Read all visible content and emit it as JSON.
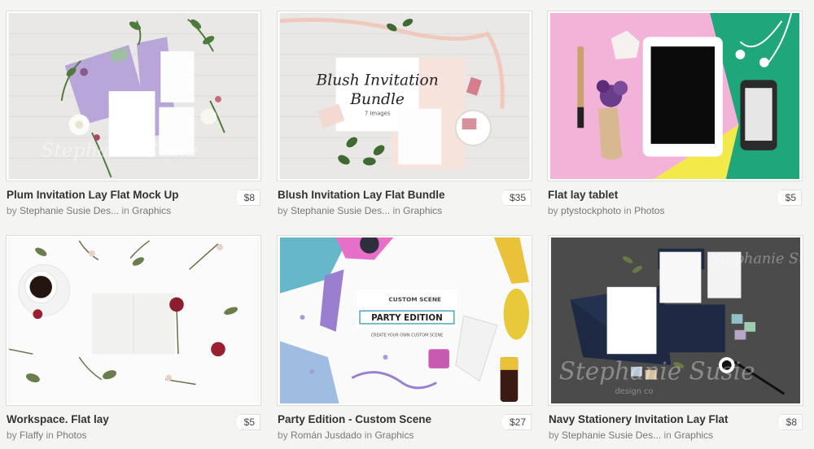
{
  "products": [
    {
      "title": "Plum Invitation Lay Flat Mock Up",
      "author": "Stephanie Susie Des...",
      "in_word": "in",
      "by_word": "by",
      "category": "Graphics",
      "price": "$8",
      "watermark": "Stephanie Susie"
    },
    {
      "title": "Blush Invitation Lay Flat Bundle",
      "author": "Stephanie Susie Des...",
      "in_word": "in",
      "by_word": "by",
      "category": "Graphics",
      "price": "$35",
      "card_title_line1": "Blush Invitation",
      "card_title_line2": "Bundle",
      "card_subtitle": "7 Images"
    },
    {
      "title": "Flat lay tablet",
      "author": "ptystockphoto",
      "in_word": "in",
      "by_word": "by",
      "category": "Photos",
      "price": "$5"
    },
    {
      "title": "Workspace. Flat lay",
      "author": "Flaffy",
      "in_word": "in",
      "by_word": "by",
      "category": "Photos",
      "price": "$5"
    },
    {
      "title": "Party Edition - Custom Scene",
      "author": "Román Jusdado",
      "in_word": "in",
      "by_word": "by",
      "category": "Graphics",
      "price": "$27",
      "badge_top": "CUSTOM SCENE",
      "badge_main": "PARTY EDITION",
      "badge_sub": "CREATE YOUR OWN CUSTOM SCENE"
    },
    {
      "title": "Navy Stationery Invitation Lay Flat",
      "author": "Stephanie Susie Des...",
      "in_word": "in",
      "by_word": "by",
      "category": "Graphics",
      "price": "$8",
      "watermark": "Stephanie Susie",
      "watermark_sub": "design co"
    }
  ]
}
